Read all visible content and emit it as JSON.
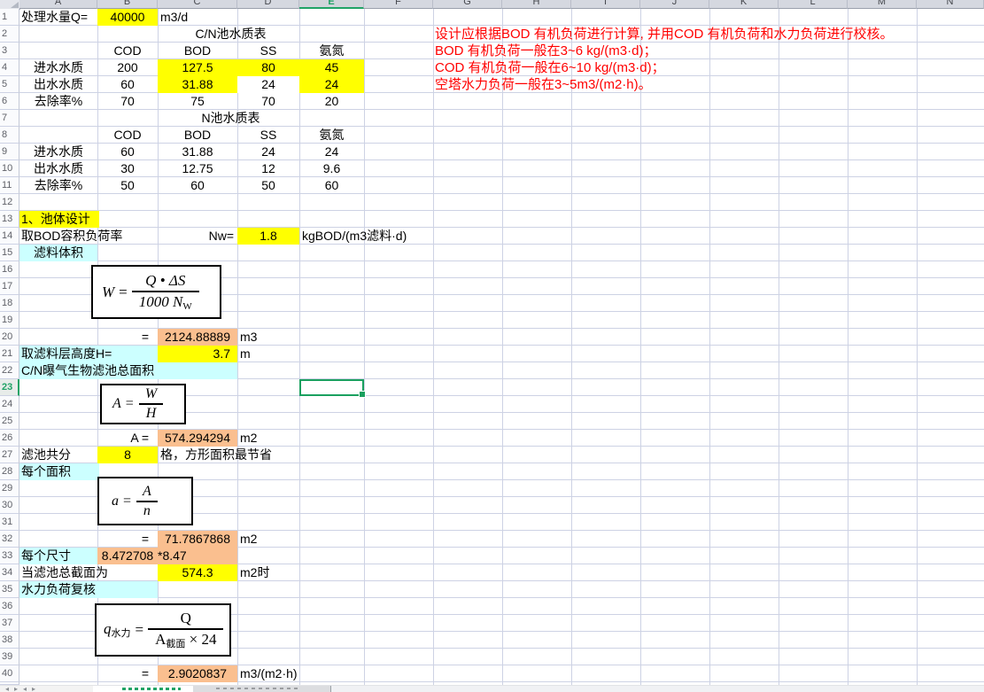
{
  "colors": {
    "highlight_yellow": "#FFFF00",
    "highlight_orange": "#FABF8F",
    "highlight_cyan": "#CCFFFF",
    "note_red": "#FF0000",
    "selection_green": "#21A366",
    "gridline": "#CDD2E4"
  },
  "column_headers": [
    "A",
    "B",
    "C",
    "D",
    "E",
    "F",
    "G",
    "H",
    "I",
    "J",
    "K",
    "L",
    "M",
    "N"
  ],
  "selected_column": "E",
  "selected_row": 23,
  "row_count": 41,
  "header": {
    "q_label": "处理水量Q=",
    "q_value": "40000",
    "q_unit": "m3/d"
  },
  "notes": {
    "line1": "设计应根据BOD 有机负荷进行计算, 并用COD 有机负荷和水力负荷进行校核。",
    "line2": "BOD 有机负荷一般在3~6 kg/(m3·d)；",
    "line3": "COD 有机负荷一般在6~10 kg/(m3·d)；",
    "line4": "空塔水力负荷一般在3~5m3/(m2·h)。"
  },
  "table_cn": {
    "title": "C/N池水质表",
    "col_headers": [
      "COD",
      "BOD",
      "SS",
      "氨氮"
    ],
    "row_labels": [
      "进水水质",
      "出水水质",
      "去除率%"
    ],
    "rows": [
      [
        "200",
        "127.5",
        "80",
        "45"
      ],
      [
        "60",
        "31.88",
        "24",
        "24"
      ],
      [
        "70",
        "75",
        "70",
        "20"
      ]
    ]
  },
  "table_n": {
    "title": "N池水质表",
    "col_headers": [
      "COD",
      "BOD",
      "SS",
      "氨氮"
    ],
    "row_labels": [
      "进水水质",
      "出水水质",
      "去除率%"
    ],
    "rows": [
      [
        "60",
        "31.88",
        "24",
        "24"
      ],
      [
        "30",
        "12.75",
        "12",
        "9.6"
      ],
      [
        "50",
        "60",
        "50",
        "60"
      ]
    ]
  },
  "design": {
    "section_title": "1、池体设计",
    "nw_label": "取BOD容积负荷率",
    "nw_symbol": "Nw=",
    "nw_value": "1.8",
    "nw_unit": "kgBOD/(m3滤料·d)",
    "volume_label": "滤料体积",
    "w_eq": "=",
    "w_value": "2124.88889",
    "w_unit": "m3",
    "h_label": "取滤料层高度H=",
    "h_value": "3.7",
    "h_unit": "m",
    "area_label": "C/N曝气生物滤池总面积",
    "a_eq": "A =",
    "a_value": "574.294294",
    "a_unit": "m2",
    "cells_label": "滤池共分",
    "cells_value": "8",
    "cells_tail": "格，方形面积最节省",
    "each_area_label": "每个面积",
    "ea_eq": "=",
    "ea_value": "71.7867868",
    "ea_unit": "m2",
    "size_label": "每个尺寸",
    "size_value": "8.472708",
    "size_value2": "*8.47",
    "section_label": "当滤池总截面为",
    "section_value": "574.3",
    "section_unit": "m2时",
    "check_label": "水力负荷复核",
    "q_eq": "=",
    "q_value": "2.9020837",
    "q_unit": "m3/(m2·h)"
  },
  "formula_w": {
    "lhs": "W",
    "eq": "=",
    "num": "Q • ΔS",
    "den": "1000 N",
    "den_sub": "W"
  },
  "formula_area": {
    "lhs": "A",
    "eq": "=",
    "num": "W",
    "den": "H"
  },
  "formula_each": {
    "lhs": "a",
    "eq": "=",
    "num": "A",
    "den": "n"
  },
  "formula_q": {
    "lhs": "q",
    "lhs_sub": "水力",
    "eq": "=",
    "num": "Q",
    "den": "A",
    "den_sub": "截面",
    "den_tail": "× 24"
  }
}
